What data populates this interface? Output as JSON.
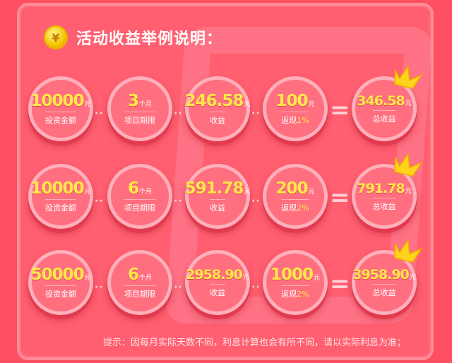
{
  "header": {
    "coin_symbol": "¥",
    "title": "活动收益举例说明："
  },
  "rows": [
    {
      "invest": {
        "value": "10000",
        "unit": "元",
        "label": "投资金额"
      },
      "term": {
        "value": "3",
        "unit": "个月",
        "label": "项目期限"
      },
      "earn": {
        "value": "246.58",
        "unit": "元",
        "label": "收益"
      },
      "cashback": {
        "value": "100",
        "unit": "元",
        "label": "返现",
        "pct": "1%"
      },
      "total": {
        "value": "346.58",
        "unit": "元",
        "label": "总收益"
      }
    },
    {
      "invest": {
        "value": "10000",
        "unit": "元",
        "label": "投资金额"
      },
      "term": {
        "value": "6",
        "unit": "个月",
        "label": "项目期限"
      },
      "earn": {
        "value": "591.78",
        "unit": "元",
        "label": "收益"
      },
      "cashback": {
        "value": "200",
        "unit": "元",
        "label": "返现",
        "pct": "2%"
      },
      "total": {
        "value": "791.78",
        "unit": "元",
        "label": "总收益"
      }
    },
    {
      "invest": {
        "value": "50000",
        "unit": "元",
        "label": "投资金额"
      },
      "term": {
        "value": "6",
        "unit": "个月",
        "label": "项目期限"
      },
      "earn": {
        "value": "2958.90",
        "unit": "元",
        "label": "收益"
      },
      "cashback": {
        "value": "1000",
        "unit": "元",
        "label": "返现",
        "pct": "2%"
      },
      "total": {
        "value": "3958.90",
        "unit": "元",
        "label": "总收益"
      }
    }
  ],
  "operators": {
    "dots": "··",
    "equals": "="
  },
  "footer": {
    "hint": "提示：因每月实际天数不同，利息计算也会有所不同，请以实际利息为准；"
  },
  "colors": {
    "background": "#ff4f62",
    "value": "#ffe74a",
    "circle": "#ff6f80",
    "crown": "#ffd21c"
  },
  "icons": {
    "coin": "yen-coin-icon",
    "crown": "crown-icon"
  }
}
